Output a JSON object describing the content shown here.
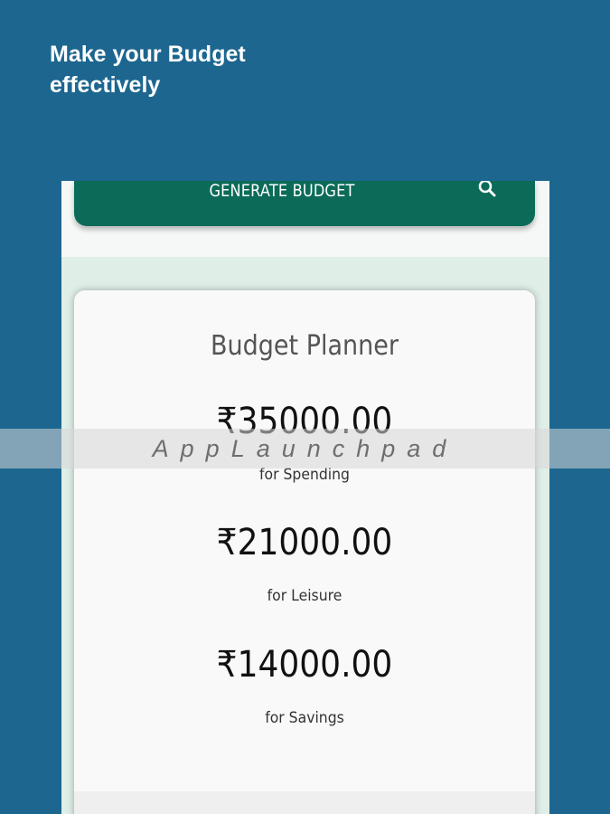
{
  "headline": {
    "line1": "Make your Budget",
    "line2": "effectively"
  },
  "appbar": {
    "button_label": "GENERATE BUDGET",
    "search_icon": "search-icon"
  },
  "card": {
    "title": "Budget Planner",
    "items": [
      {
        "amount": "₹35000.00",
        "label": "for Spending"
      },
      {
        "amount": "₹21000.00",
        "label": "for Leisure"
      },
      {
        "amount": "₹14000.00",
        "label": "for Savings"
      }
    ]
  },
  "watermark": "AppLaunchpad",
  "colors": {
    "background": "#1d6690",
    "appbar": "#0b6b58",
    "card": "#f9f9f9"
  }
}
